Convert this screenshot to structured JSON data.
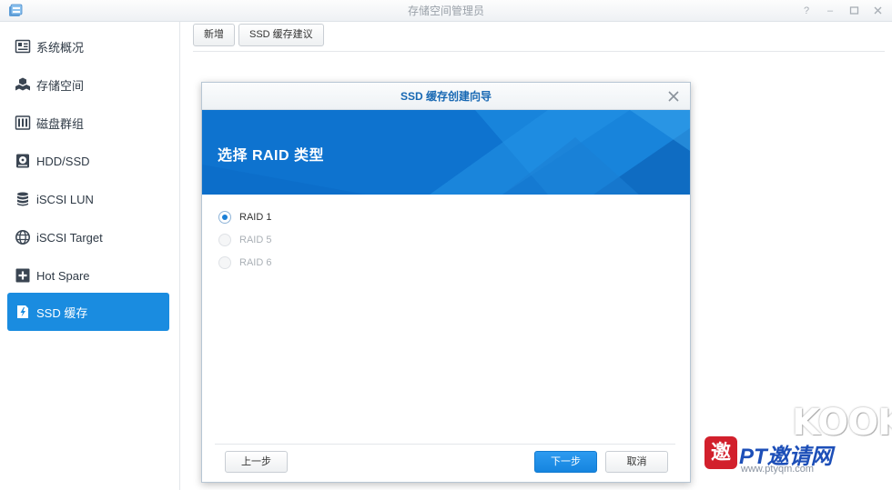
{
  "window": {
    "title": "存储空间管理员"
  },
  "sidebar": {
    "items": [
      {
        "label": "系统概况",
        "icon": "overview-icon",
        "active": false
      },
      {
        "label": "存储空间",
        "icon": "storage-space-icon",
        "active": false
      },
      {
        "label": "磁盘群组",
        "icon": "disk-group-icon",
        "active": false
      },
      {
        "label": "HDD/SSD",
        "icon": "hdd-icon",
        "active": false
      },
      {
        "label": "iSCSI LUN",
        "icon": "iscsi-lun-icon",
        "active": false
      },
      {
        "label": "iSCSI Target",
        "icon": "iscsi-target-icon",
        "active": false
      },
      {
        "label": "Hot Spare",
        "icon": "hot-spare-icon",
        "active": false
      },
      {
        "label": "SSD 缓存",
        "icon": "ssd-cache-icon",
        "active": true
      }
    ]
  },
  "toolbar": {
    "add_label": "新增",
    "ssd_advice_label": "SSD 缓存建议"
  },
  "dialog": {
    "title": "SSD 缓存创建向导",
    "step_title": "选择 RAID 类型",
    "options": [
      {
        "label": "RAID 1",
        "checked": true,
        "disabled": false
      },
      {
        "label": "RAID 5",
        "checked": false,
        "disabled": true
      },
      {
        "label": "RAID 6",
        "checked": false,
        "disabled": true
      }
    ],
    "back_label": "上一步",
    "next_label": "下一步",
    "cancel_label": "取消"
  },
  "watermark": {
    "brand": "KOOK",
    "seal": "邀",
    "text": "PT邀请网",
    "url": "www.ptyqm.com"
  },
  "colors": {
    "accent": "#1a8ce0",
    "banner": "#0f77d2",
    "dialog_title": "#1768b3"
  }
}
